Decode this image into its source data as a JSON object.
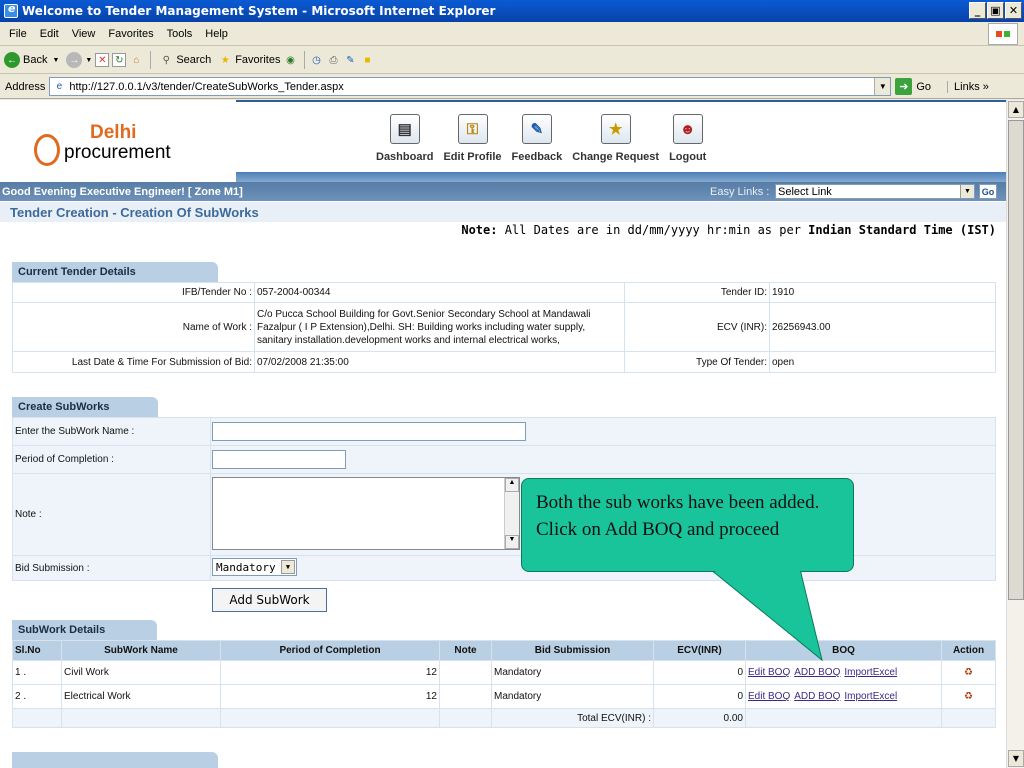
{
  "window": {
    "title": "Welcome to Tender Management System - Microsoft Internet Explorer"
  },
  "menu": [
    "File",
    "Edit",
    "View",
    "Favorites",
    "Tools",
    "Help"
  ],
  "toolbar": {
    "back": "Back",
    "search": "Search",
    "favorites": "Favorites"
  },
  "address": {
    "label": "Address",
    "url": "http://127.0.0.1/v3/tender/CreateSubWorks_Tender.aspx",
    "go": "Go",
    "links": "Links"
  },
  "brand": {
    "delhi": "Delhi",
    "procurement": "procurement"
  },
  "nav": [
    {
      "label": "Dashboard",
      "icon": "dashboard-icon"
    },
    {
      "label": "Edit Profile",
      "icon": "key-icon"
    },
    {
      "label": "Feedback",
      "icon": "feedback-icon"
    },
    {
      "label": "Change Request",
      "icon": "change-request-icon"
    },
    {
      "label": "Logout",
      "icon": "logout-icon"
    }
  ],
  "greeting": "Good Evening Executive Engineer!  [ Zone M1]",
  "easy_links": {
    "label": "Easy Links :",
    "selected": "Select Link",
    "go": "Go"
  },
  "page_title": "Tender Creation - Creation Of SubWorks",
  "note": {
    "bold": "Note:",
    "text": " All Dates are in dd/mm/yyyy hr:min as per ",
    "bold2": "Indian Standard Time (IST)"
  },
  "current": {
    "header": "Current Tender Details",
    "ifb_label": "IFB/Tender No :",
    "ifb": "057-2004-00344",
    "tender_id_label": "Tender ID:",
    "tender_id": "1910",
    "work_label": "Name of Work :",
    "work": "C/o Pucca School Building for Govt.Senior Secondary School at Mandawali Fazalpur ( I P Extension),Delhi. SH: Building works including water supply, sanitary installation.development works and internal electrical works,",
    "ecv_label": "ECV (INR):",
    "ecv": "26256943.00",
    "lastdate_label": "Last Date & Time For Submission of Bid:",
    "lastdate": "07/02/2008 21:35:00",
    "type_label": "Type Of Tender:",
    "type": "open"
  },
  "create": {
    "header": "Create SubWorks",
    "name_label": "Enter the SubWork Name :",
    "period_label": "Period of Completion :",
    "note_label": "Note :",
    "bid_label": "Bid Submission :",
    "bid_value": "Mandatory",
    "add_button": "Add SubWork"
  },
  "callout": "Both the sub works have been added. Click on Add BOQ and proceed",
  "subwork": {
    "header": "SubWork Details",
    "columns": [
      "Sl.No",
      "SubWork Name",
      "Period of Completion",
      "Note",
      "Bid Submission",
      "ECV(INR)",
      "BOQ",
      "Action"
    ],
    "rows": [
      {
        "sl": "1 .",
        "name": "Civil Work",
        "period": "12",
        "note": "",
        "bid": "Mandatory",
        "ecv": "0"
      },
      {
        "sl": "2 .",
        "name": "Electrical Work",
        "period": "12",
        "note": "",
        "bid": "Mandatory",
        "ecv": "0"
      }
    ],
    "boq_links": [
      "Edit BOQ",
      "ADD BOQ",
      "ImportExcel"
    ],
    "total_label": "Total ECV(INR) :",
    "total": "0.00"
  },
  "colors": {
    "callout": "#1ac49a",
    "header_band": "#577ca5",
    "section_tab": "#b9cfe3",
    "logo_orange": "#e06a1f"
  }
}
